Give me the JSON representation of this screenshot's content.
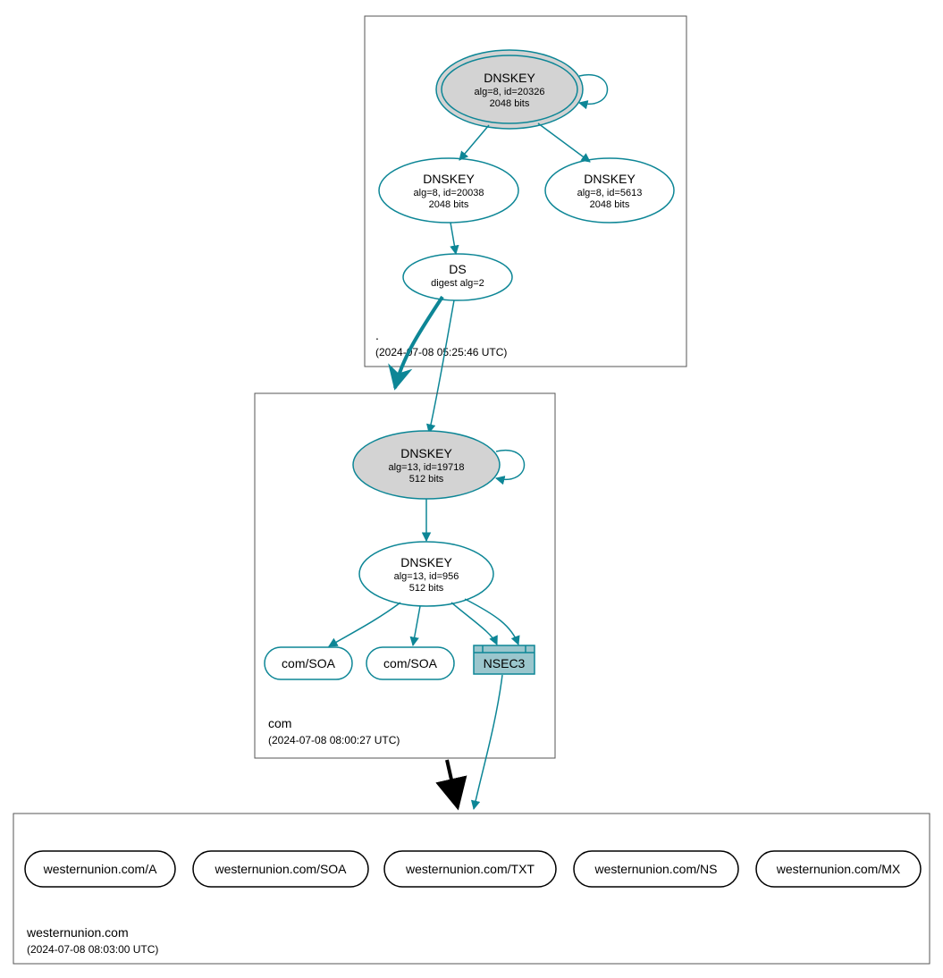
{
  "colors": {
    "teal": "#0d8696",
    "gray": "#d3d3d3",
    "nsecFill": "#9bc6cd",
    "black": "#000000"
  },
  "zones": {
    "root": {
      "name": ".",
      "timestamp": "(2024-07-08 05:25:46 UTC)",
      "ksk": {
        "title": "DNSKEY",
        "sub1": "alg=8, id=20326",
        "sub2": "2048 bits"
      },
      "zsk": {
        "title": "DNSKEY",
        "sub1": "alg=8, id=20038",
        "sub2": "2048 bits"
      },
      "zsk2": {
        "title": "DNSKEY",
        "sub1": "alg=8, id=5613",
        "sub2": "2048 bits"
      },
      "ds": {
        "title": "DS",
        "sub1": "digest alg=2"
      }
    },
    "com": {
      "name": "com",
      "timestamp": "(2024-07-08 08:00:27 UTC)",
      "ksk": {
        "title": "DNSKEY",
        "sub1": "alg=13, id=19718",
        "sub2": "512 bits"
      },
      "zsk": {
        "title": "DNSKEY",
        "sub1": "alg=13, id=956",
        "sub2": "512 bits"
      },
      "soa1": "com/SOA",
      "soa2": "com/SOA",
      "nsec": "NSEC3"
    },
    "leaf": {
      "name": "westernunion.com",
      "timestamp": "(2024-07-08 08:03:00 UTC)",
      "rr": [
        "westernunion.com/A",
        "westernunion.com/SOA",
        "westernunion.com/TXT",
        "westernunion.com/NS",
        "westernunion.com/MX"
      ]
    }
  }
}
